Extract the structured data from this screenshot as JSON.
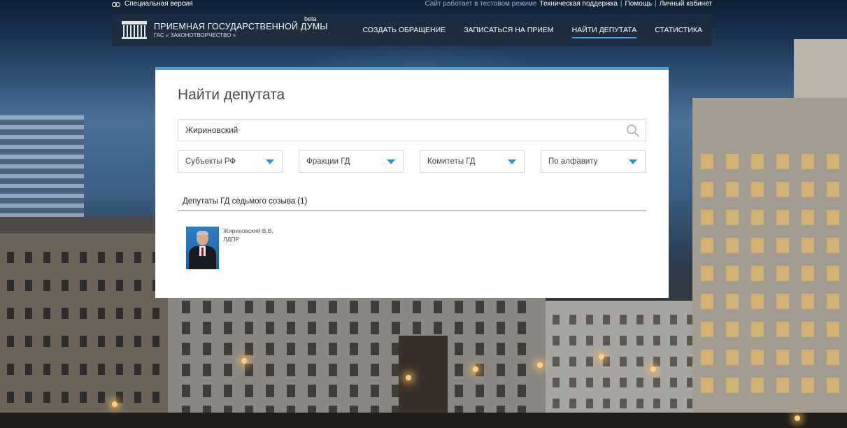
{
  "topbar": {
    "special_version": "Специальная версия",
    "test_mode_text": "Сайт работает в тестовом режиме",
    "links": [
      "Техническая поддержка",
      "Помощь",
      "Личный кабинет"
    ],
    "separator": "|"
  },
  "header": {
    "logo_title": "ПРИЕМНАЯ ГОСУДАРСТВЕННОЙ ДУМЫ",
    "logo_subtitle": "ГАС « ЗАКОНОТВОРЧЕСТВО »",
    "beta_label": "beta",
    "nav": [
      {
        "label": "СОЗДАТЬ ОБРАЩЕНИЕ",
        "active": false
      },
      {
        "label": "ЗАПИСАТЬСЯ НА ПРИЕМ",
        "active": false
      },
      {
        "label": "НАЙТИ ДЕПУТАТА",
        "active": true
      },
      {
        "label": "СТАТИСТИКА",
        "active": false
      }
    ],
    "active_underline_color": "#4aa3df"
  },
  "card": {
    "title": "Найти депутата",
    "search_value": "Жириновский",
    "search_icon": "magnifier-icon",
    "filters": [
      {
        "label": "Субъекты РФ"
      },
      {
        "label": "Фракции ГД"
      },
      {
        "label": "Комитеты ГД"
      },
      {
        "label": "По алфавиту"
      }
    ],
    "filter_arrow_color": "#3a8fcf",
    "accent_border_color": "#4ea1d8",
    "section_title": "Депутаты ГД седьмого созыва (1)",
    "results": [
      {
        "name": "Жириновский В.В.",
        "party": "ЛДПР",
        "photo": "deputy-portrait"
      }
    ]
  }
}
